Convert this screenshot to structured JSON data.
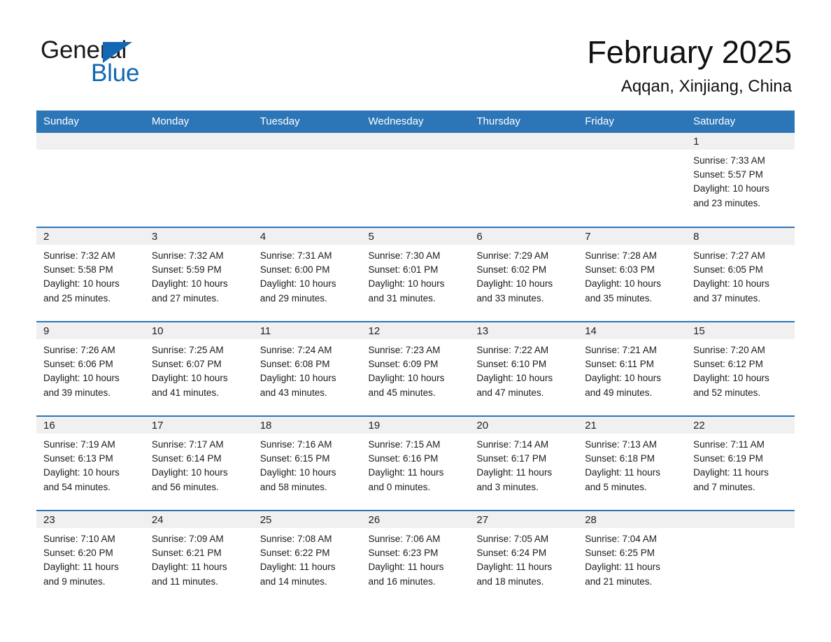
{
  "brand": {
    "name_part1": "General",
    "name_part2": "Blue",
    "triangle_color": "#1268b3",
    "text_color": "#1a1a1a"
  },
  "header": {
    "title": "February 2025",
    "location": "Aqqan, Xinjiang, China"
  },
  "theme": {
    "header_blue": "#2c76b8",
    "date_band_gray": "#f0f0f0",
    "text_color": "#1b1b1b"
  },
  "weekday_headers": [
    "Sunday",
    "Monday",
    "Tuesday",
    "Wednesday",
    "Thursday",
    "Friday",
    "Saturday"
  ],
  "weeks": [
    [
      {
        "date": "",
        "empty": true,
        "sunrise": "",
        "sunset": "",
        "daylight_line1": "",
        "daylight_line2": ""
      },
      {
        "date": "",
        "empty": true,
        "sunrise": "",
        "sunset": "",
        "daylight_line1": "",
        "daylight_line2": ""
      },
      {
        "date": "",
        "empty": true,
        "sunrise": "",
        "sunset": "",
        "daylight_line1": "",
        "daylight_line2": ""
      },
      {
        "date": "",
        "empty": true,
        "sunrise": "",
        "sunset": "",
        "daylight_line1": "",
        "daylight_line2": ""
      },
      {
        "date": "",
        "empty": true,
        "sunrise": "",
        "sunset": "",
        "daylight_line1": "",
        "daylight_line2": ""
      },
      {
        "date": "",
        "empty": true,
        "sunrise": "",
        "sunset": "",
        "daylight_line1": "",
        "daylight_line2": ""
      },
      {
        "date": "1",
        "empty": false,
        "sunrise": "Sunrise: 7:33 AM",
        "sunset": "Sunset: 5:57 PM",
        "daylight_line1": "Daylight: 10 hours",
        "daylight_line2": "and 23 minutes."
      }
    ],
    [
      {
        "date": "2",
        "empty": false,
        "sunrise": "Sunrise: 7:32 AM",
        "sunset": "Sunset: 5:58 PM",
        "daylight_line1": "Daylight: 10 hours",
        "daylight_line2": "and 25 minutes."
      },
      {
        "date": "3",
        "empty": false,
        "sunrise": "Sunrise: 7:32 AM",
        "sunset": "Sunset: 5:59 PM",
        "daylight_line1": "Daylight: 10 hours",
        "daylight_line2": "and 27 minutes."
      },
      {
        "date": "4",
        "empty": false,
        "sunrise": "Sunrise: 7:31 AM",
        "sunset": "Sunset: 6:00 PM",
        "daylight_line1": "Daylight: 10 hours",
        "daylight_line2": "and 29 minutes."
      },
      {
        "date": "5",
        "empty": false,
        "sunrise": "Sunrise: 7:30 AM",
        "sunset": "Sunset: 6:01 PM",
        "daylight_line1": "Daylight: 10 hours",
        "daylight_line2": "and 31 minutes."
      },
      {
        "date": "6",
        "empty": false,
        "sunrise": "Sunrise: 7:29 AM",
        "sunset": "Sunset: 6:02 PM",
        "daylight_line1": "Daylight: 10 hours",
        "daylight_line2": "and 33 minutes."
      },
      {
        "date": "7",
        "empty": false,
        "sunrise": "Sunrise: 7:28 AM",
        "sunset": "Sunset: 6:03 PM",
        "daylight_line1": "Daylight: 10 hours",
        "daylight_line2": "and 35 minutes."
      },
      {
        "date": "8",
        "empty": false,
        "sunrise": "Sunrise: 7:27 AM",
        "sunset": "Sunset: 6:05 PM",
        "daylight_line1": "Daylight: 10 hours",
        "daylight_line2": "and 37 minutes."
      }
    ],
    [
      {
        "date": "9",
        "empty": false,
        "sunrise": "Sunrise: 7:26 AM",
        "sunset": "Sunset: 6:06 PM",
        "daylight_line1": "Daylight: 10 hours",
        "daylight_line2": "and 39 minutes."
      },
      {
        "date": "10",
        "empty": false,
        "sunrise": "Sunrise: 7:25 AM",
        "sunset": "Sunset: 6:07 PM",
        "daylight_line1": "Daylight: 10 hours",
        "daylight_line2": "and 41 minutes."
      },
      {
        "date": "11",
        "empty": false,
        "sunrise": "Sunrise: 7:24 AM",
        "sunset": "Sunset: 6:08 PM",
        "daylight_line1": "Daylight: 10 hours",
        "daylight_line2": "and 43 minutes."
      },
      {
        "date": "12",
        "empty": false,
        "sunrise": "Sunrise: 7:23 AM",
        "sunset": "Sunset: 6:09 PM",
        "daylight_line1": "Daylight: 10 hours",
        "daylight_line2": "and 45 minutes."
      },
      {
        "date": "13",
        "empty": false,
        "sunrise": "Sunrise: 7:22 AM",
        "sunset": "Sunset: 6:10 PM",
        "daylight_line1": "Daylight: 10 hours",
        "daylight_line2": "and 47 minutes."
      },
      {
        "date": "14",
        "empty": false,
        "sunrise": "Sunrise: 7:21 AM",
        "sunset": "Sunset: 6:11 PM",
        "daylight_line1": "Daylight: 10 hours",
        "daylight_line2": "and 49 minutes."
      },
      {
        "date": "15",
        "empty": false,
        "sunrise": "Sunrise: 7:20 AM",
        "sunset": "Sunset: 6:12 PM",
        "daylight_line1": "Daylight: 10 hours",
        "daylight_line2": "and 52 minutes."
      }
    ],
    [
      {
        "date": "16",
        "empty": false,
        "sunrise": "Sunrise: 7:19 AM",
        "sunset": "Sunset: 6:13 PM",
        "daylight_line1": "Daylight: 10 hours",
        "daylight_line2": "and 54 minutes."
      },
      {
        "date": "17",
        "empty": false,
        "sunrise": "Sunrise: 7:17 AM",
        "sunset": "Sunset: 6:14 PM",
        "daylight_line1": "Daylight: 10 hours",
        "daylight_line2": "and 56 minutes."
      },
      {
        "date": "18",
        "empty": false,
        "sunrise": "Sunrise: 7:16 AM",
        "sunset": "Sunset: 6:15 PM",
        "daylight_line1": "Daylight: 10 hours",
        "daylight_line2": "and 58 minutes."
      },
      {
        "date": "19",
        "empty": false,
        "sunrise": "Sunrise: 7:15 AM",
        "sunset": "Sunset: 6:16 PM",
        "daylight_line1": "Daylight: 11 hours",
        "daylight_line2": "and 0 minutes."
      },
      {
        "date": "20",
        "empty": false,
        "sunrise": "Sunrise: 7:14 AM",
        "sunset": "Sunset: 6:17 PM",
        "daylight_line1": "Daylight: 11 hours",
        "daylight_line2": "and 3 minutes."
      },
      {
        "date": "21",
        "empty": false,
        "sunrise": "Sunrise: 7:13 AM",
        "sunset": "Sunset: 6:18 PM",
        "daylight_line1": "Daylight: 11 hours",
        "daylight_line2": "and 5 minutes."
      },
      {
        "date": "22",
        "empty": false,
        "sunrise": "Sunrise: 7:11 AM",
        "sunset": "Sunset: 6:19 PM",
        "daylight_line1": "Daylight: 11 hours",
        "daylight_line2": "and 7 minutes."
      }
    ],
    [
      {
        "date": "23",
        "empty": false,
        "sunrise": "Sunrise: 7:10 AM",
        "sunset": "Sunset: 6:20 PM",
        "daylight_line1": "Daylight: 11 hours",
        "daylight_line2": "and 9 minutes."
      },
      {
        "date": "24",
        "empty": false,
        "sunrise": "Sunrise: 7:09 AM",
        "sunset": "Sunset: 6:21 PM",
        "daylight_line1": "Daylight: 11 hours",
        "daylight_line2": "and 11 minutes."
      },
      {
        "date": "25",
        "empty": false,
        "sunrise": "Sunrise: 7:08 AM",
        "sunset": "Sunset: 6:22 PM",
        "daylight_line1": "Daylight: 11 hours",
        "daylight_line2": "and 14 minutes."
      },
      {
        "date": "26",
        "empty": false,
        "sunrise": "Sunrise: 7:06 AM",
        "sunset": "Sunset: 6:23 PM",
        "daylight_line1": "Daylight: 11 hours",
        "daylight_line2": "and 16 minutes."
      },
      {
        "date": "27",
        "empty": false,
        "sunrise": "Sunrise: 7:05 AM",
        "sunset": "Sunset: 6:24 PM",
        "daylight_line1": "Daylight: 11 hours",
        "daylight_line2": "and 18 minutes."
      },
      {
        "date": "28",
        "empty": false,
        "sunrise": "Sunrise: 7:04 AM",
        "sunset": "Sunset: 6:25 PM",
        "daylight_line1": "Daylight: 11 hours",
        "daylight_line2": "and 21 minutes."
      },
      {
        "date": "",
        "empty": true,
        "sunrise": "",
        "sunset": "",
        "daylight_line1": "",
        "daylight_line2": ""
      }
    ]
  ]
}
